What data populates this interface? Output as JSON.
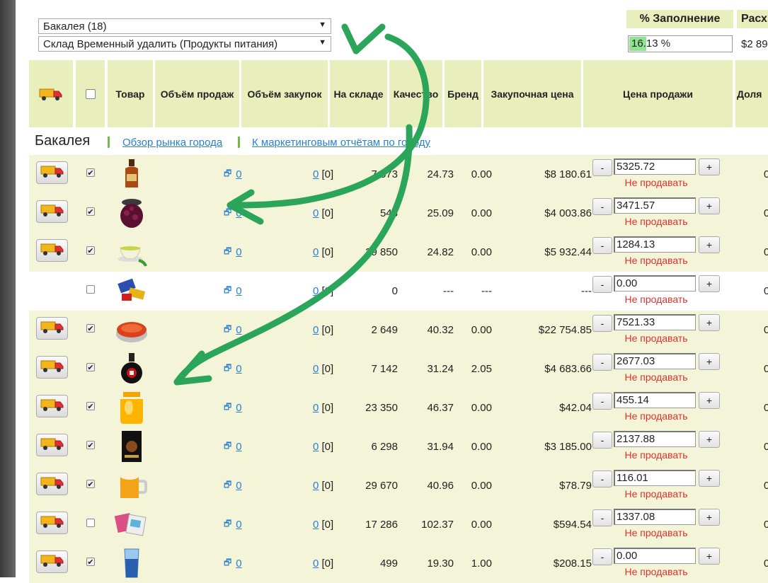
{
  "selectors": {
    "category": "Бакалея (18)",
    "warehouse": "Склад Временный удалить (Продукты питания)"
  },
  "fill": {
    "header": "% Заполнение",
    "value": "16.13 %",
    "fraction": 0.1613
  },
  "expenses": {
    "header": "Расх",
    "value": "$2 89"
  },
  "headers": {
    "product": "Товар",
    "sales_volume": "Объём продаж",
    "purchase_volume": "Объём закупок",
    "in_stock": "На складе",
    "quality": "Качество",
    "brand": "Бренд",
    "purchase_price": "Закупочная цена",
    "sale_price": "Цена продажи",
    "share": "Доля"
  },
  "section": {
    "title": "Бакалея",
    "link_market": "Обзор рынка города",
    "link_reports": "К маркетинговым отчётам по городу"
  },
  "rows": [
    {
      "img": "cognac-icon",
      "truck": true,
      "checked": true,
      "sales": "0",
      "purchase": "0",
      "purchase_bracket": "[0]",
      "stock": "7 573",
      "quality": "24.73",
      "brand": "0.00",
      "price": "$8 180.61",
      "sale_price": "5325.72",
      "no_sell": "Не продавать",
      "share": "0"
    },
    {
      "img": "jam-jar-icon",
      "truck": true,
      "checked": true,
      "sales": "0",
      "purchase": "0",
      "purchase_bracket": "[0]",
      "stock": "548",
      "quality": "25.09",
      "brand": "0.00",
      "price": "$4 003.86",
      "sale_price": "3471.57",
      "no_sell": "Не продавать",
      "share": "0"
    },
    {
      "img": "tea-cup-icon",
      "truck": true,
      "checked": true,
      "sales": "0",
      "purchase": "0",
      "purchase_bracket": "[0]",
      "stock": "29 850",
      "quality": "24.82",
      "brand": "0.00",
      "price": "$5 932.44",
      "sale_price": "1284.13",
      "no_sell": "Не продавать",
      "share": "0"
    },
    {
      "img": "candy-icon",
      "truck": false,
      "checked": false,
      "sales": "0",
      "purchase": "0",
      "purchase_bracket": "[0]",
      "stock": "0",
      "quality": "---",
      "brand": "---",
      "price": "---",
      "sale_price": "0.00",
      "no_sell": "Не продавать",
      "share": "0"
    },
    {
      "img": "caviar-tin-icon",
      "truck": true,
      "checked": true,
      "sales": "0",
      "purchase": "0",
      "purchase_bracket": "[0]",
      "stock": "2 649",
      "quality": "40.32",
      "brand": "0.00",
      "price": "$22 754.85",
      "sale_price": "7521.33",
      "no_sell": "Не продавать",
      "share": "0"
    },
    {
      "img": "liqueur-bottle-icon",
      "truck": true,
      "checked": true,
      "sales": "0",
      "purchase": "0",
      "purchase_bracket": "[0]",
      "stock": "7 142",
      "quality": "31.24",
      "brand": "2.05",
      "price": "$4 683.66",
      "sale_price": "2677.03",
      "no_sell": "Не продавать",
      "share": "0"
    },
    {
      "img": "honey-jar-icon",
      "truck": true,
      "checked": true,
      "sales": "0",
      "purchase": "0",
      "purchase_bracket": "[0]",
      "stock": "23 350",
      "quality": "46.37",
      "brand": "0.00",
      "price": "$42.04",
      "sale_price": "455.14",
      "no_sell": "Не продавать",
      "share": "0"
    },
    {
      "img": "coffee-pack-icon",
      "truck": true,
      "checked": true,
      "sales": "0",
      "purchase": "0",
      "purchase_bracket": "[0]",
      "stock": "6 298",
      "quality": "31.94",
      "brand": "0.00",
      "price": "$3 185.00",
      "sale_price": "2137.88",
      "no_sell": "Не продавать",
      "share": "0"
    },
    {
      "img": "beer-mug-icon",
      "truck": true,
      "checked": true,
      "sales": "0",
      "purchase": "0",
      "purchase_bracket": "[0]",
      "stock": "29 670",
      "quality": "40.96",
      "brand": "0.00",
      "price": "$78.79",
      "sale_price": "116.01",
      "no_sell": "Не продавать",
      "share": "0"
    },
    {
      "img": "snack-packs-icon",
      "truck": true,
      "checked": false,
      "sales": "0",
      "purchase": "0",
      "purchase_bracket": "[0]",
      "stock": "17 286",
      "quality": "102.37",
      "brand": "0.00",
      "price": "$594.54",
      "sale_price": "1337.08",
      "no_sell": "Не продавать",
      "share": "0"
    },
    {
      "img": "water-glass-icon",
      "truck": true,
      "checked": true,
      "sales": "0",
      "purchase": "0",
      "purchase_bracket": "[0]",
      "stock": "499",
      "quality": "19.30",
      "brand": "1.00",
      "price": "$208.15",
      "sale_price": "0.00",
      "no_sell": "Не продавать",
      "share": "0"
    }
  ],
  "colors": {
    "header_bg": "#e8efbd",
    "row_shade": "#f4f4d8",
    "link": "#2a7fd4",
    "no_sell": "#e0312e",
    "annotation": "#2aa55a"
  }
}
